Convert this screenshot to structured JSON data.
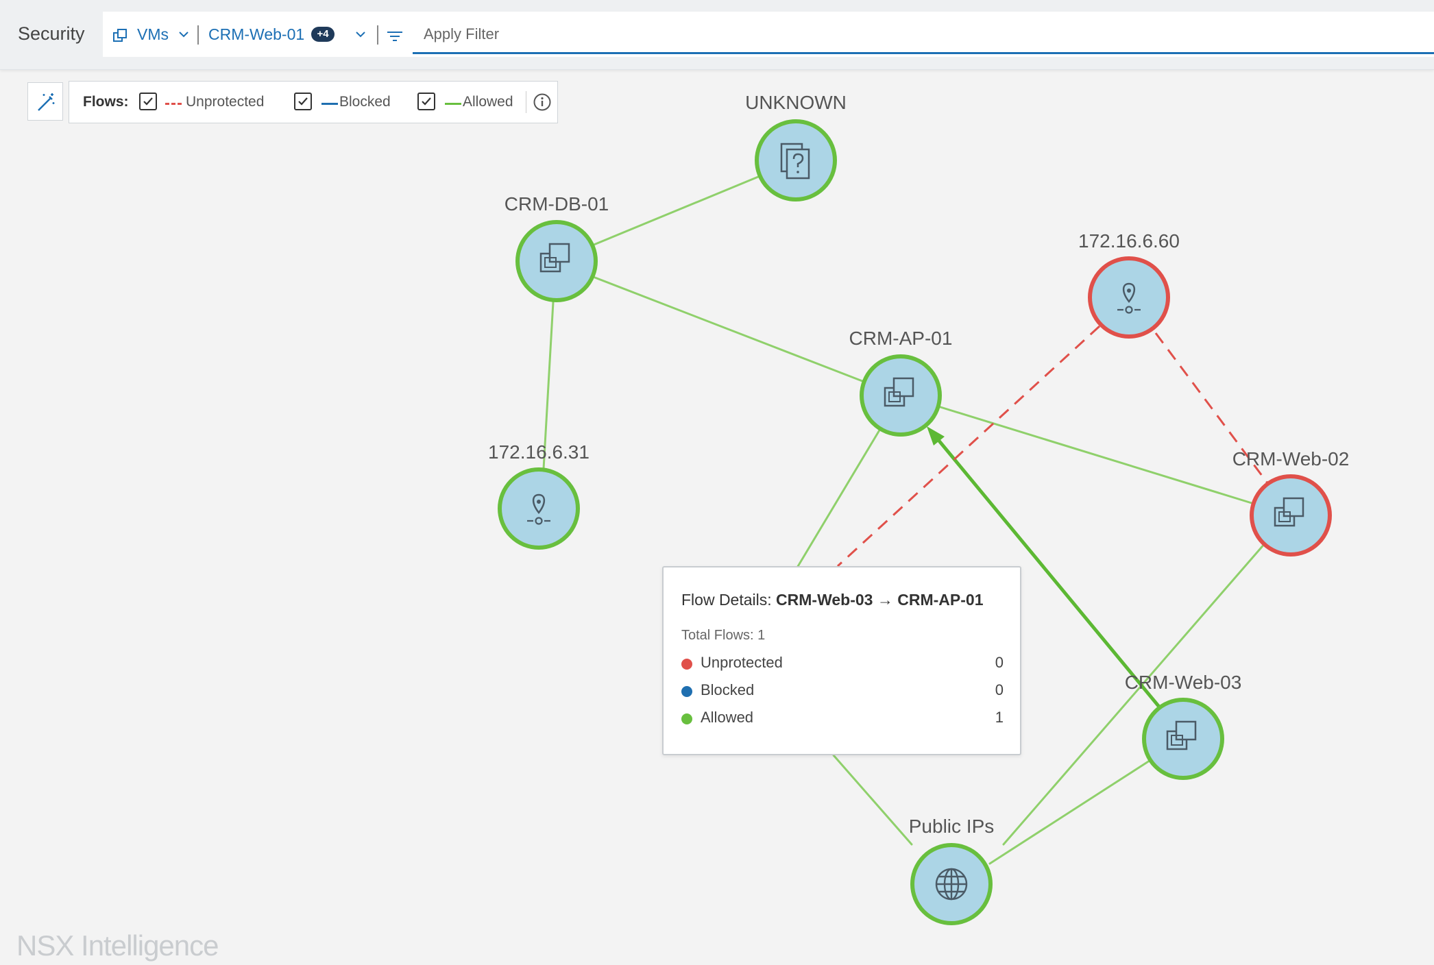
{
  "header": {
    "section_title": "Security",
    "object_type": "VMs",
    "selected_vm": "CRM-Web-01",
    "selected_extra_count": "+4",
    "filter_placeholder": "Apply Filter"
  },
  "legend": {
    "title": "Flows:",
    "items": [
      {
        "label": "Unprotected",
        "checked": true,
        "color": "#e0504a",
        "style": "dashed"
      },
      {
        "label": "Blocked",
        "checked": true,
        "color": "#1f6fb0",
        "style": "solid"
      },
      {
        "label": "Allowed",
        "checked": true,
        "color": "#68bf3e",
        "style": "solid"
      }
    ]
  },
  "nodes": [
    {
      "id": "unknown",
      "label": "UNKNOWN",
      "icon": "unknown-document-icon",
      "status": "allowed"
    },
    {
      "id": "crm-db-01",
      "label": "CRM-DB-01",
      "icon": "vm-icon",
      "status": "allowed"
    },
    {
      "id": "ip-60",
      "label": "172.16.6.60",
      "icon": "ip-address-icon",
      "status": "unprotected"
    },
    {
      "id": "crm-ap-01",
      "label": "CRM-AP-01",
      "icon": "vm-icon",
      "status": "allowed"
    },
    {
      "id": "ip-31",
      "label": "172.16.6.31",
      "icon": "ip-address-icon",
      "status": "allowed"
    },
    {
      "id": "crm-web-02",
      "label": "CRM-Web-02",
      "icon": "vm-icon",
      "status": "unprotected"
    },
    {
      "id": "crm-web-03",
      "label": "CRM-Web-03",
      "icon": "vm-icon",
      "status": "allowed"
    },
    {
      "id": "public-ips",
      "label": "Public IPs",
      "icon": "globe-icon",
      "status": "allowed"
    }
  ],
  "colors": {
    "allowed": "#68bf3e",
    "unprotected": "#e0504a",
    "blocked": "#1f6fb0",
    "node_fill": "#acd5e6"
  },
  "tooltip": {
    "title_prefix": "Flow Details:",
    "source": "CRM-Web-03",
    "arrow": "→",
    "target": "CRM-AP-01",
    "total_flows_label": "Total Flows: 1",
    "rows": [
      {
        "label": "Unprotected",
        "value": "0",
        "color": "#e0504a"
      },
      {
        "label": "Blocked",
        "value": "0",
        "color": "#1f6fb0"
      },
      {
        "label": "Allowed",
        "value": "1",
        "color": "#68bf3e"
      }
    ]
  },
  "watermark": "NSX Intelligence"
}
